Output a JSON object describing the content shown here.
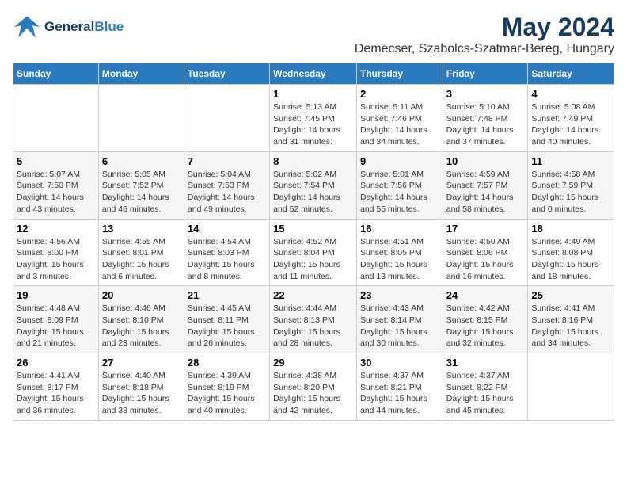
{
  "header": {
    "logo": {
      "general": "General",
      "blue": "Blue"
    },
    "month": "May 2024",
    "location": "Demecser, Szabolcs-Szatmar-Bereg, Hungary"
  },
  "weekdays": [
    "Sunday",
    "Monday",
    "Tuesday",
    "Wednesday",
    "Thursday",
    "Friday",
    "Saturday"
  ],
  "weeks": [
    [
      {
        "day": "",
        "info": ""
      },
      {
        "day": "",
        "info": ""
      },
      {
        "day": "",
        "info": ""
      },
      {
        "day": "1",
        "info": "Sunrise: 5:13 AM\nSunset: 7:45 PM\nDaylight: 14 hours and 31 minutes."
      },
      {
        "day": "2",
        "info": "Sunrise: 5:11 AM\nSunset: 7:46 PM\nDaylight: 14 hours and 34 minutes."
      },
      {
        "day": "3",
        "info": "Sunrise: 5:10 AM\nSunset: 7:48 PM\nDaylight: 14 hours and 37 minutes."
      },
      {
        "day": "4",
        "info": "Sunrise: 5:08 AM\nSunset: 7:49 PM\nDaylight: 14 hours and 40 minutes."
      }
    ],
    [
      {
        "day": "5",
        "info": "Sunrise: 5:07 AM\nSunset: 7:50 PM\nDaylight: 14 hours and 43 minutes."
      },
      {
        "day": "6",
        "info": "Sunrise: 5:05 AM\nSunset: 7:52 PM\nDaylight: 14 hours and 46 minutes."
      },
      {
        "day": "7",
        "info": "Sunrise: 5:04 AM\nSunset: 7:53 PM\nDaylight: 14 hours and 49 minutes."
      },
      {
        "day": "8",
        "info": "Sunrise: 5:02 AM\nSunset: 7:54 PM\nDaylight: 14 hours and 52 minutes."
      },
      {
        "day": "9",
        "info": "Sunrise: 5:01 AM\nSunset: 7:56 PM\nDaylight: 14 hours and 55 minutes."
      },
      {
        "day": "10",
        "info": "Sunrise: 4:59 AM\nSunset: 7:57 PM\nDaylight: 14 hours and 58 minutes."
      },
      {
        "day": "11",
        "info": "Sunrise: 4:58 AM\nSunset: 7:59 PM\nDaylight: 15 hours and 0 minutes."
      }
    ],
    [
      {
        "day": "12",
        "info": "Sunrise: 4:56 AM\nSunset: 8:00 PM\nDaylight: 15 hours and 3 minutes."
      },
      {
        "day": "13",
        "info": "Sunrise: 4:55 AM\nSunset: 8:01 PM\nDaylight: 15 hours and 6 minutes."
      },
      {
        "day": "14",
        "info": "Sunrise: 4:54 AM\nSunset: 8:03 PM\nDaylight: 15 hours and 8 minutes."
      },
      {
        "day": "15",
        "info": "Sunrise: 4:52 AM\nSunset: 8:04 PM\nDaylight: 15 hours and 11 minutes."
      },
      {
        "day": "16",
        "info": "Sunrise: 4:51 AM\nSunset: 8:05 PM\nDaylight: 15 hours and 13 minutes."
      },
      {
        "day": "17",
        "info": "Sunrise: 4:50 AM\nSunset: 8:06 PM\nDaylight: 15 hours and 16 minutes."
      },
      {
        "day": "18",
        "info": "Sunrise: 4:49 AM\nSunset: 8:08 PM\nDaylight: 15 hours and 18 minutes."
      }
    ],
    [
      {
        "day": "19",
        "info": "Sunrise: 4:48 AM\nSunset: 8:09 PM\nDaylight: 15 hours and 21 minutes."
      },
      {
        "day": "20",
        "info": "Sunrise: 4:46 AM\nSunset: 8:10 PM\nDaylight: 15 hours and 23 minutes."
      },
      {
        "day": "21",
        "info": "Sunrise: 4:45 AM\nSunset: 8:11 PM\nDaylight: 15 hours and 26 minutes."
      },
      {
        "day": "22",
        "info": "Sunrise: 4:44 AM\nSunset: 8:13 PM\nDaylight: 15 hours and 28 minutes."
      },
      {
        "day": "23",
        "info": "Sunrise: 4:43 AM\nSunset: 8:14 PM\nDaylight: 15 hours and 30 minutes."
      },
      {
        "day": "24",
        "info": "Sunrise: 4:42 AM\nSunset: 8:15 PM\nDaylight: 15 hours and 32 minutes."
      },
      {
        "day": "25",
        "info": "Sunrise: 4:41 AM\nSunset: 8:16 PM\nDaylight: 15 hours and 34 minutes."
      }
    ],
    [
      {
        "day": "26",
        "info": "Sunrise: 4:41 AM\nSunset: 8:17 PM\nDaylight: 15 hours and 36 minutes."
      },
      {
        "day": "27",
        "info": "Sunrise: 4:40 AM\nSunset: 8:18 PM\nDaylight: 15 hours and 38 minutes."
      },
      {
        "day": "28",
        "info": "Sunrise: 4:39 AM\nSunset: 8:19 PM\nDaylight: 15 hours and 40 minutes."
      },
      {
        "day": "29",
        "info": "Sunrise: 4:38 AM\nSunset: 8:20 PM\nDaylight: 15 hours and 42 minutes."
      },
      {
        "day": "30",
        "info": "Sunrise: 4:37 AM\nSunset: 8:21 PM\nDaylight: 15 hours and 44 minutes."
      },
      {
        "day": "31",
        "info": "Sunrise: 4:37 AM\nSunset: 8:22 PM\nDaylight: 15 hours and 45 minutes."
      },
      {
        "day": "",
        "info": ""
      }
    ]
  ]
}
